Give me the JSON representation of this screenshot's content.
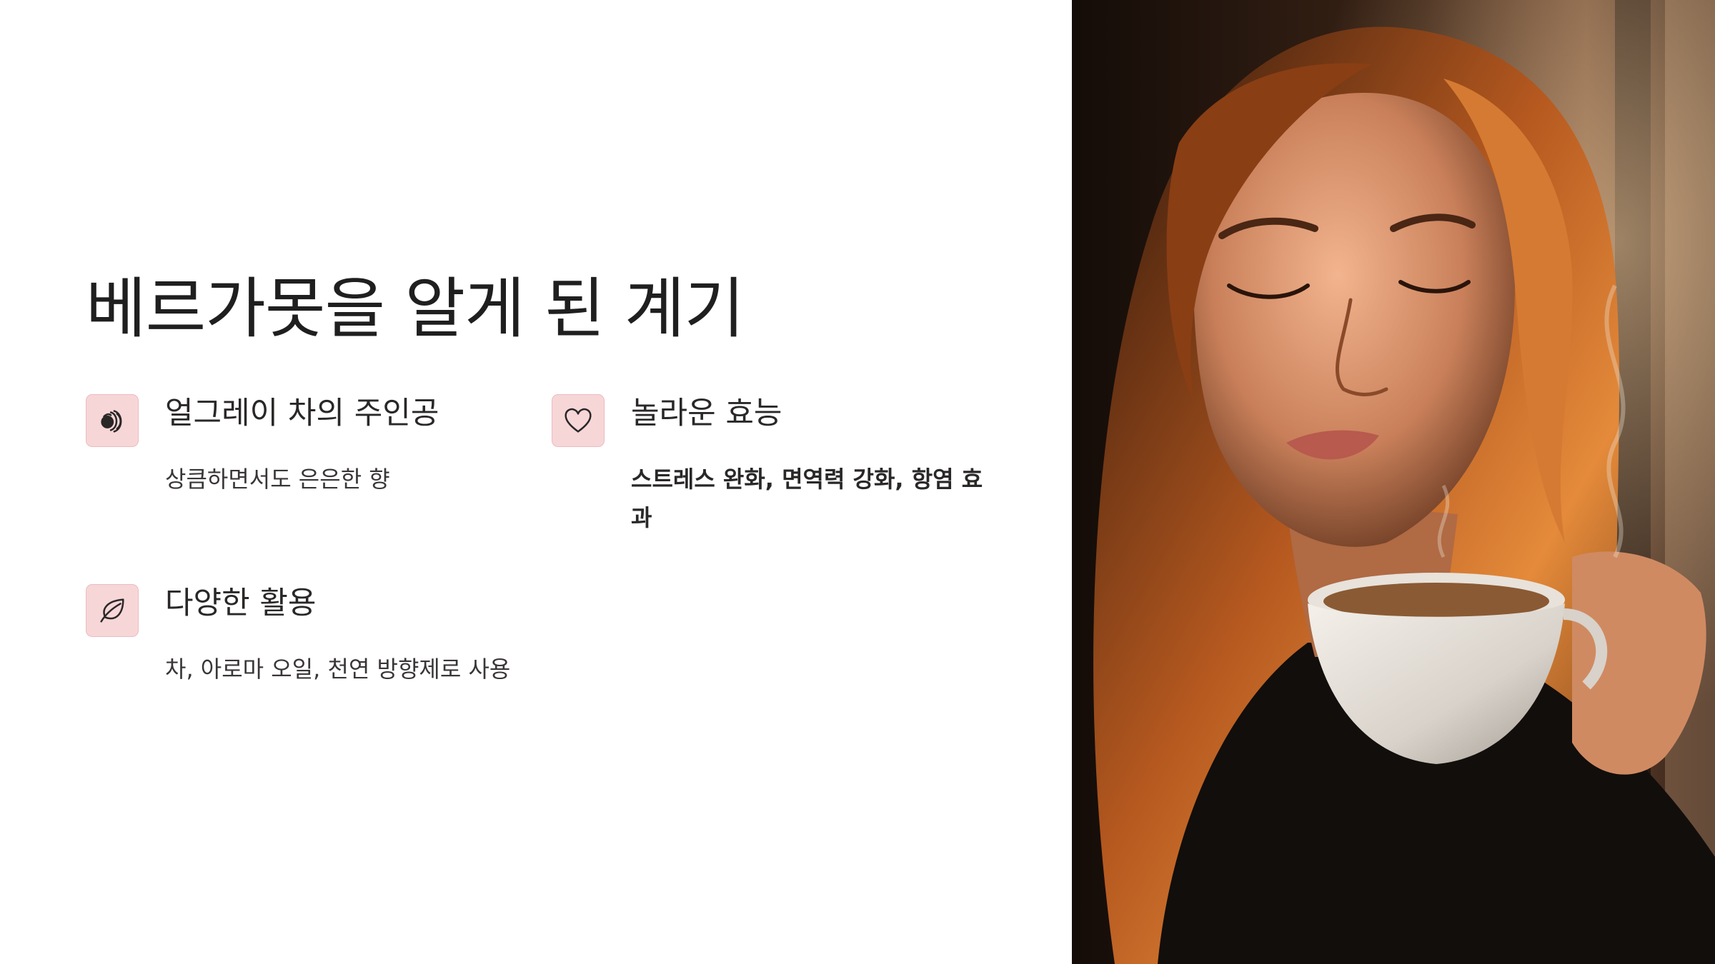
{
  "slide": {
    "title": "베르가못을 알게 된 계기",
    "features": [
      {
        "icon": "earl-grey-icon",
        "title": "얼그레이 차의 주인공",
        "description": "상큼하면서도 은은한 향"
      },
      {
        "icon": "heart-icon",
        "title": "놀라운 효능",
        "description": "스트레스 완화, 면역력 강화, 항염 효과"
      },
      {
        "icon": "leaf-icon",
        "title": "다양한 활용",
        "description": "차, 아로마 오일, 천연 방향제로 사용"
      }
    ],
    "photo": {
      "subject": "woman-smelling-tea-cup"
    }
  },
  "colors": {
    "background": "#ffffff",
    "text": "#1f1f1f",
    "icon_bg": "#f7d6d8",
    "icon_border": "#ecbcc0"
  }
}
